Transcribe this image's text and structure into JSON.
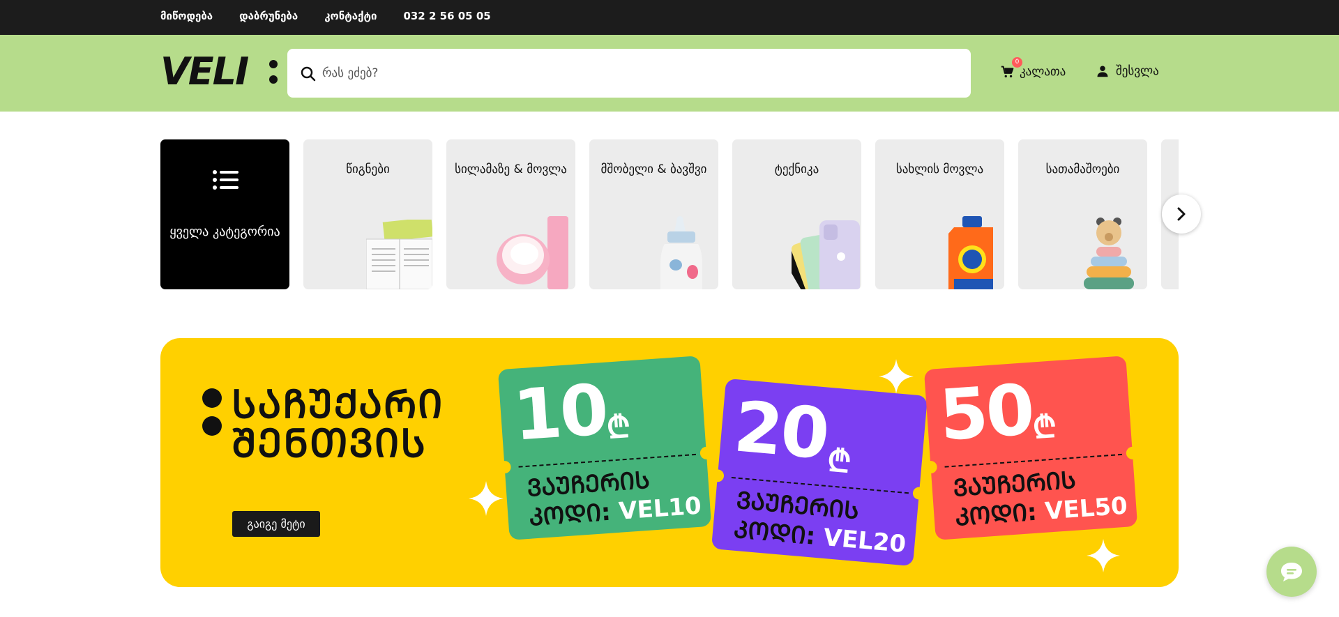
{
  "topbar": {
    "links": [
      "მიწოდება",
      "დაბრუნება",
      "კონტაქტი"
    ],
    "phone": "032 2 56 05 05"
  },
  "header": {
    "logo_text": "VELI",
    "search_placeholder": "რას ეძებ?",
    "cart_label": "კალათა",
    "cart_count": "0",
    "login_label": "შესვლა"
  },
  "categories": {
    "all_label": "ყველა კატეგორია",
    "items": [
      {
        "label": "წიგნები"
      },
      {
        "label": "სილამაზე & მოვლა"
      },
      {
        "label": "მშობელი & ბავშვი"
      },
      {
        "label": "ტექნიკა"
      },
      {
        "label": "სახლის მოვლა"
      },
      {
        "label": "სათამაშოები"
      }
    ]
  },
  "banner": {
    "title_line1": "ᲡᲐᲩᲣᲥᲐᲠᲘ",
    "title_line2": "ᲨᲔᲜᲗᲕᲘᲡ",
    "button_label": "გაიგე მეტი",
    "coupons": [
      {
        "amount": "10",
        "currency": "₾",
        "label_line1": "ᲕᲐᲣᲩᲔᲠᲘᲡ",
        "label_line2": "ᲙᲝᲓᲘ:",
        "code": "VEL10",
        "color": "#45b37a"
      },
      {
        "amount": "20",
        "currency": "₾",
        "label_line1": "ᲕᲐᲣᲩᲔᲠᲘᲡ",
        "label_line2": "ᲙᲝᲓᲘ:",
        "code": "VEL20",
        "color": "#7b3ff2"
      },
      {
        "amount": "50",
        "currency": "₾",
        "label_line1": "ᲕᲐᲣᲩᲔᲠᲘᲡ",
        "label_line2": "ᲙᲝᲓᲘ:",
        "code": "VEL50",
        "color": "#ff544f"
      }
    ]
  },
  "colors": {
    "topbar": "#1c1c1c",
    "header": "#b6dc8b",
    "banner": "#ffd000",
    "category_tile": "#ececec"
  },
  "icons": {
    "search": "search-icon",
    "cart": "cart-icon",
    "user": "user-icon",
    "list": "list-icon",
    "next": "chevron-right-icon",
    "chat": "chat-icon"
  }
}
